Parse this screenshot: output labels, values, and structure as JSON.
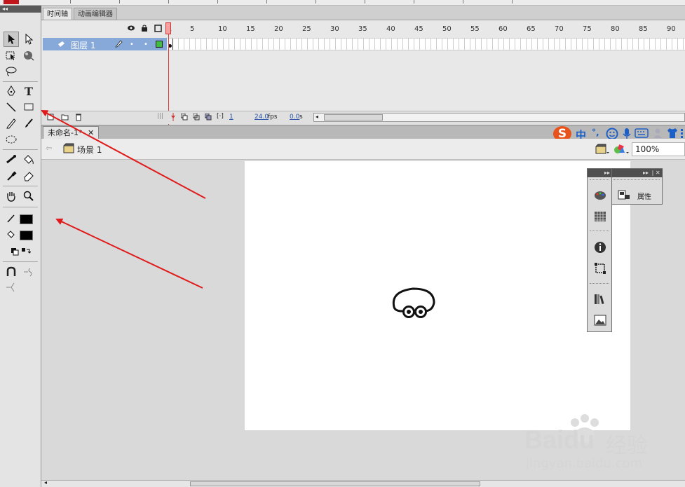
{
  "timeline": {
    "tabs": [
      "时间轴",
      "动画编辑器"
    ],
    "frame_numbers": [
      "1",
      "5",
      "10",
      "15",
      "20",
      "25",
      "30",
      "35",
      "40",
      "45",
      "50",
      "55",
      "60",
      "65",
      "70",
      "75",
      "80",
      "85",
      "90"
    ],
    "layer_name": "图层 1",
    "status": {
      "current_frame": "1",
      "fps": "24.0",
      "fps_unit": "fps",
      "time": "0.0",
      "time_unit": "s"
    }
  },
  "document": {
    "tab_title": "未命名-1*",
    "scene_label": "场景 1",
    "zoom": "100%"
  },
  "panel": {
    "properties_label": "属性"
  },
  "ime": {
    "chinese_label": "中",
    "punct_label": "°,"
  },
  "watermark": {
    "brand": "Baidu",
    "brand_cn": "经验",
    "url": "jingyan.baidu.com"
  },
  "colors": {
    "arrow_red": "#e01a1a",
    "layer_selected": "#87a9d9",
    "playhead": "#e8696b"
  },
  "icons": [
    "selection-tool-icon",
    "subselection-tool-icon",
    "free-transform-icon",
    "3d-rotation-icon",
    "lasso-icon",
    "pen-icon",
    "text-icon",
    "line-icon",
    "rectangle-icon",
    "pencil-icon",
    "brush-icon",
    "deco-icon",
    "bone-icon",
    "paint-bucket-icon",
    "eyedropper-icon",
    "eraser-icon",
    "hand-icon",
    "zoom-icon",
    "stroke-color-icon",
    "fill-color-icon",
    "swap-colors-icon",
    "snap-icon"
  ]
}
